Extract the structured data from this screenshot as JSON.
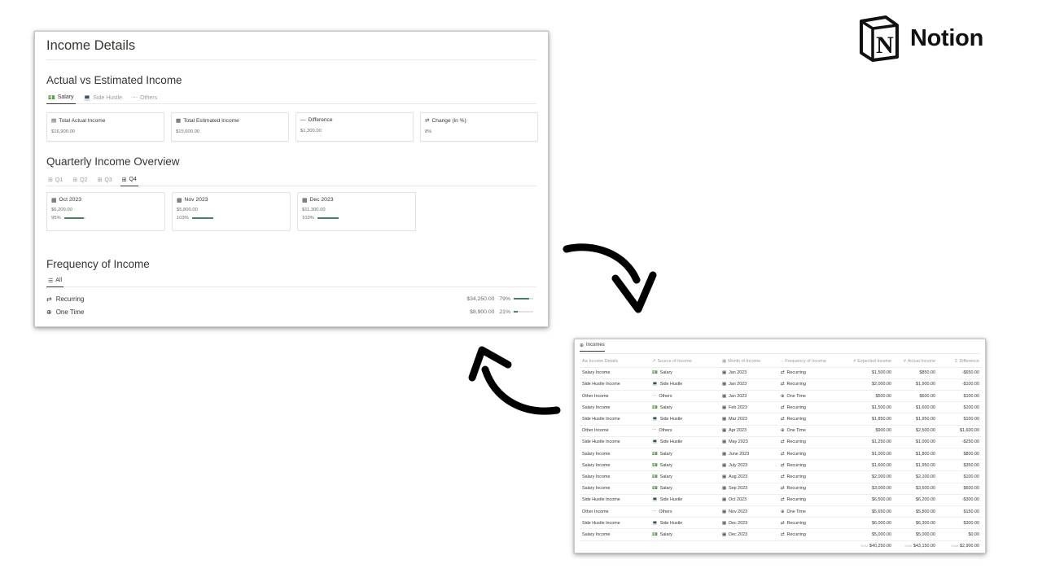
{
  "logo": {
    "text": "Notion"
  },
  "main": {
    "title": "Income Details",
    "actual_vs_estimated": {
      "heading": "Actual vs Estimated Income",
      "tabs": [
        {
          "icon": "💵",
          "label": "Salary",
          "active": true
        },
        {
          "icon": "💻",
          "label": "Side Hustle",
          "active": false
        },
        {
          "icon": "⋯",
          "label": "Others",
          "active": false
        }
      ],
      "cards": [
        {
          "icon": "▤",
          "title": "Total Actual Income",
          "value": "$16,900.00"
        },
        {
          "icon": "▦",
          "title": "Total Estimated Income",
          "value": "$15,600.00"
        },
        {
          "icon": "—",
          "title": "Difference",
          "value": "$1,300.00"
        },
        {
          "icon": "⇄",
          "title": "Change (in %)",
          "value": "8%"
        }
      ]
    },
    "quarterly": {
      "heading": "Quarterly Income Overview",
      "tabs": [
        {
          "label": "Q1",
          "active": false
        },
        {
          "label": "Q2",
          "active": false
        },
        {
          "label": "Q3",
          "active": false
        },
        {
          "label": "Q4",
          "active": true
        }
      ],
      "cards": [
        {
          "title": "Oct 2023",
          "value": "$6,200.00",
          "percent_label": "95%",
          "progress": 0.95
        },
        {
          "title": "Nov 2023",
          "value": "$5,800.00",
          "percent_label": "103%",
          "progress": 1.0
        },
        {
          "title": "Dec 2023",
          "value": "$11,300.00",
          "percent_label": "103%",
          "progress": 1.0
        }
      ]
    },
    "frequency": {
      "heading": "Frequency of Income",
      "tab_label": "All",
      "rows": [
        {
          "icon": "⇄",
          "label": "Recurring",
          "amount": "$34,250.00",
          "percent_label": "79%",
          "progress": 0.79
        },
        {
          "icon": "⊕",
          "label": "One Time",
          "amount": "$8,900.00",
          "percent_label": "21%",
          "progress": 0.21
        }
      ]
    }
  },
  "db": {
    "tab_label": "Incomes",
    "columns": [
      "Income Details",
      "Source of Income",
      "Month of Income",
      "Frequency of Income",
      "Expected Income",
      "Actual Income",
      "Difference"
    ],
    "column_icons": [
      "Aa",
      "↗",
      "▦",
      "◌",
      "#",
      "#",
      "Σ"
    ],
    "rows": [
      {
        "details": "Salary Income",
        "source": "Salary",
        "month": "Jan 2023",
        "freq": "Recurring",
        "expected": "$1,500.00",
        "actual": "$850.00",
        "diff": "-$650.00"
      },
      {
        "details": "Side Hustle Income",
        "source": "Side Hustle",
        "month": "Jan 2023",
        "freq": "Recurring",
        "expected": "$2,000.00",
        "actual": "$1,900.00",
        "diff": "-$100.00"
      },
      {
        "details": "Other Income",
        "source": "Others",
        "month": "Jan 2023",
        "freq": "One Time",
        "expected": "$500.00",
        "actual": "$600.00",
        "diff": "$100.00"
      },
      {
        "details": "Salary Income",
        "source": "Salary",
        "month": "Feb 2023",
        "freq": "Recurring",
        "expected": "$1,500.00",
        "actual": "$1,600.00",
        "diff": "$100.00"
      },
      {
        "details": "Side Hustle Income",
        "source": "Side Hustle",
        "month": "Mar 2023",
        "freq": "Recurring",
        "expected": "$1,850.00",
        "actual": "$1,950.00",
        "diff": "$100.00"
      },
      {
        "details": "Other Income",
        "source": "Others",
        "month": "Apr 2023",
        "freq": "One Time",
        "expected": "$900.00",
        "actual": "$2,500.00",
        "diff": "$1,600.00"
      },
      {
        "details": "Side Hustle Income",
        "source": "Side Hustle",
        "month": "May 2023",
        "freq": "Recurring",
        "expected": "$1,250.00",
        "actual": "$1,000.00",
        "diff": "-$250.00"
      },
      {
        "details": "Salary Income",
        "source": "Salary",
        "month": "June 2023",
        "freq": "Recurring",
        "expected": "$1,000.00",
        "actual": "$1,800.00",
        "diff": "$800.00"
      },
      {
        "details": "Salary Income",
        "source": "Salary",
        "month": "July 2023",
        "freq": "Recurring",
        "expected": "$1,600.00",
        "actual": "$1,950.00",
        "diff": "$350.00"
      },
      {
        "details": "Salary Income",
        "source": "Salary",
        "month": "Aug 2023",
        "freq": "Recurring",
        "expected": "$2,000.00",
        "actual": "$2,100.00",
        "diff": "$100.00"
      },
      {
        "details": "Salary Income",
        "source": "Salary",
        "month": "Sep 2023",
        "freq": "Recurring",
        "expected": "$3,000.00",
        "actual": "$3,600.00",
        "diff": "$600.00"
      },
      {
        "details": "Side Hustle Income",
        "source": "Side Hustle",
        "month": "Oct 2023",
        "freq": "Recurring",
        "expected": "$6,500.00",
        "actual": "$6,200.00",
        "diff": "-$300.00"
      },
      {
        "details": "Other Income",
        "source": "Others",
        "month": "Nov 2023",
        "freq": "One Time",
        "expected": "$5,650.00",
        "actual": "$5,800.00",
        "diff": "$150.00"
      },
      {
        "details": "Side Hustle Income",
        "source": "Side Hustle",
        "month": "Dec 2023",
        "freq": "Recurring",
        "expected": "$6,000.00",
        "actual": "$6,300.00",
        "diff": "$300.00"
      },
      {
        "details": "Salary Income",
        "source": "Salary",
        "month": "Dec 2023",
        "freq": "Recurring",
        "expected": "$5,000.00",
        "actual": "$5,000.00",
        "diff": "$0.00"
      }
    ],
    "sum_label": "SUM",
    "sums": {
      "expected": "$40,250.00",
      "actual": "$43,150.00",
      "diff": "$2,900.00"
    }
  },
  "icons": {
    "source": {
      "Salary": "💵",
      "Side Hustle": "💻",
      "Others": "⋯"
    },
    "freq": {
      "Recurring": "⇄",
      "One Time": "⊕"
    },
    "calendar": "▦"
  },
  "colors": {
    "progress": "#448361",
    "text": "#37352f",
    "muted": "#9b9a97"
  }
}
